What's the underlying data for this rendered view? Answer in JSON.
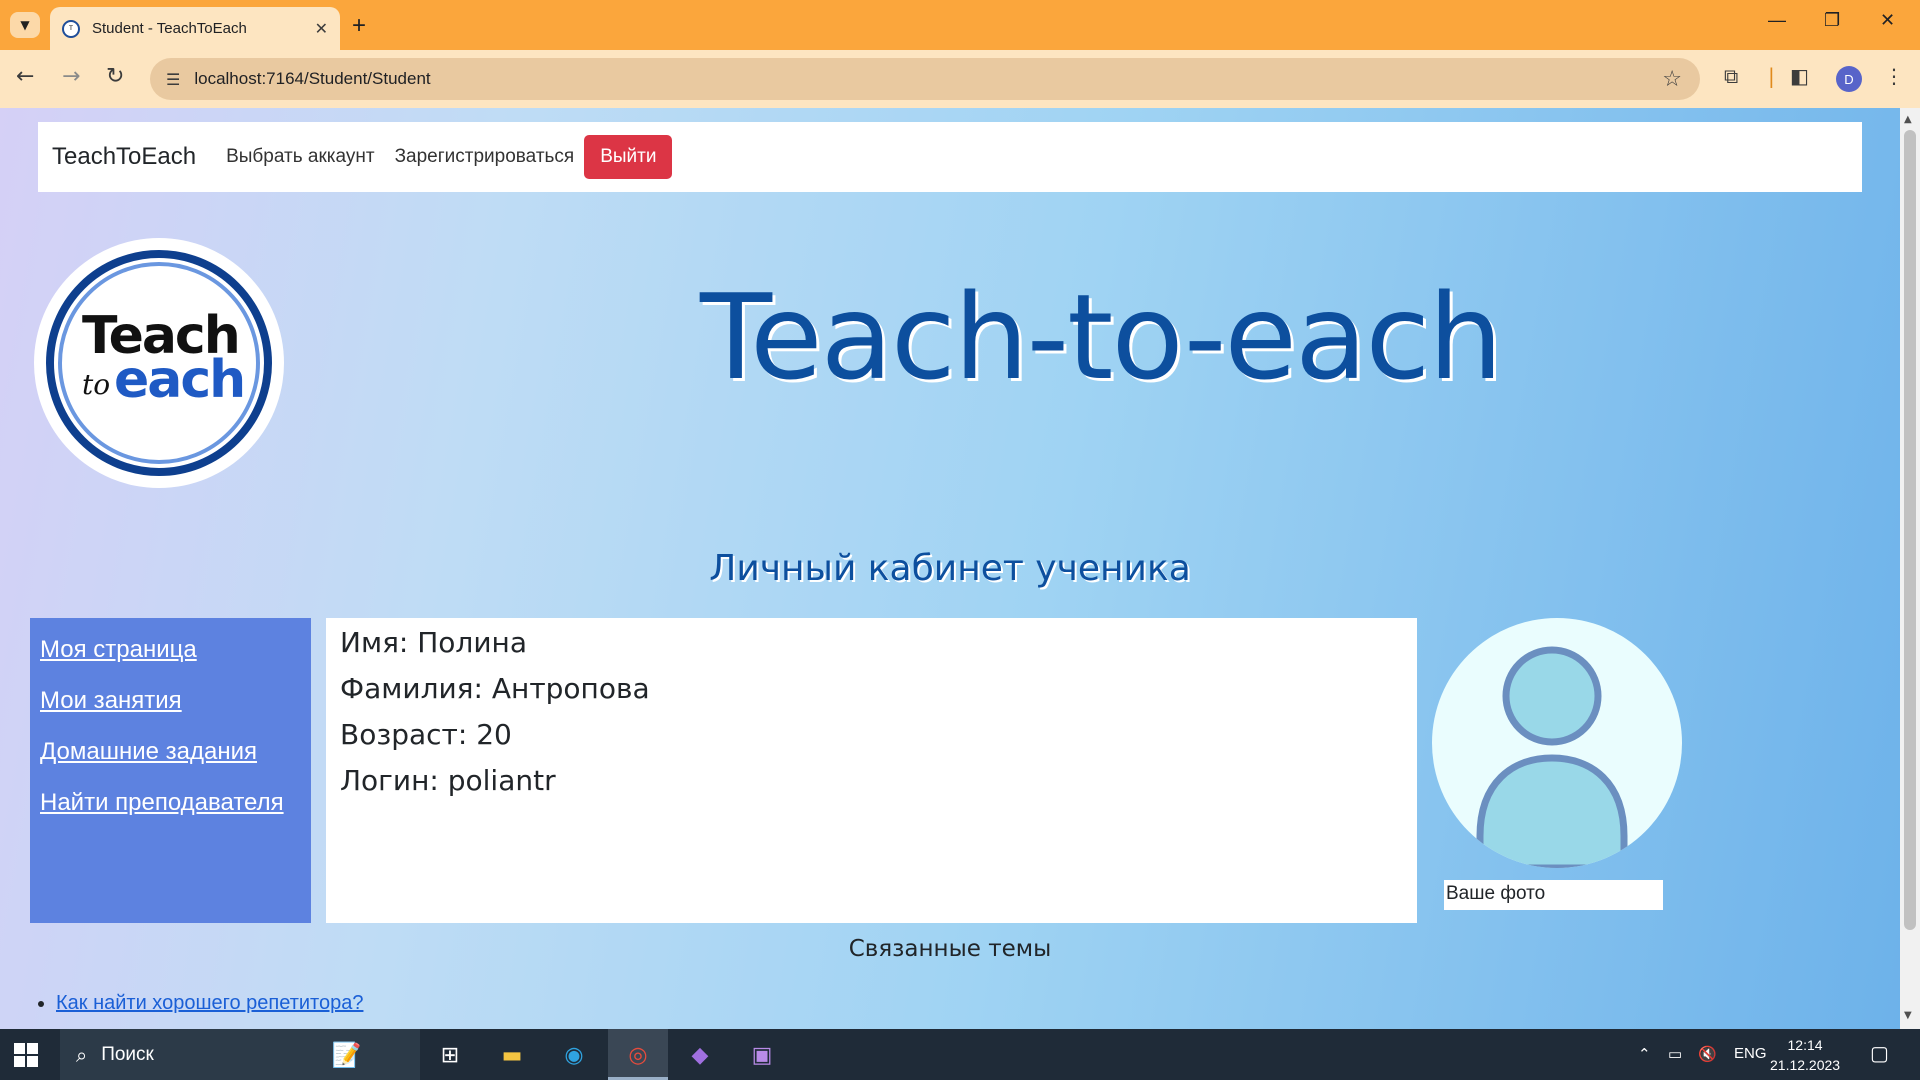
{
  "browser": {
    "tab_title": "Student - TeachToEach",
    "url": "localhost:7164/Student/Student",
    "profile_initial": "D"
  },
  "navbar": {
    "brand": "TeachToEach",
    "links": [
      "Выбрать аккаунт",
      "Зарегистрироваться"
    ],
    "logout_label": "Выйти"
  },
  "logo": {
    "teach": "Teach",
    "to": "to",
    "each": "each"
  },
  "hero_title": "Teach-to-each",
  "cabinet_title": "Личный кабинет ученика",
  "sidebar": {
    "items": [
      "Моя страница",
      "Мои занятия",
      "Домашние задания",
      "Найти преподавателя"
    ]
  },
  "profile": {
    "name_line": "Имя: Полина",
    "surname_line": "Фамилия: Антропова",
    "age_line": "Возраст: 20",
    "login_line": "Логин: poliantr"
  },
  "photo_label": "Ваше фото",
  "related": {
    "title": "Связанные темы",
    "links": [
      "Как найти хорошего репетитора?"
    ]
  },
  "taskbar": {
    "search_placeholder": "Поиск",
    "lang": "ENG",
    "time": "12:14",
    "date": "21.12.2023"
  },
  "colors": {
    "chrome_orange": "#fba63c",
    "brand_blue": "#0d4f9e",
    "sidebar_blue": "#5d82e0",
    "logout_red": "#dc3545",
    "avatar_fill": "#99d8e8",
    "avatar_stroke": "#6b8fc0"
  },
  "icons": {
    "tab_list": "chevron-down-icon",
    "back": "arrow-left-icon",
    "forward": "arrow-right-icon",
    "reload": "reload-icon",
    "site_info": "tune-icon",
    "bookmark": "star-icon",
    "extensions": "puzzle-icon",
    "side_panel": "side-panel-icon",
    "menu": "kebab-menu-icon"
  }
}
